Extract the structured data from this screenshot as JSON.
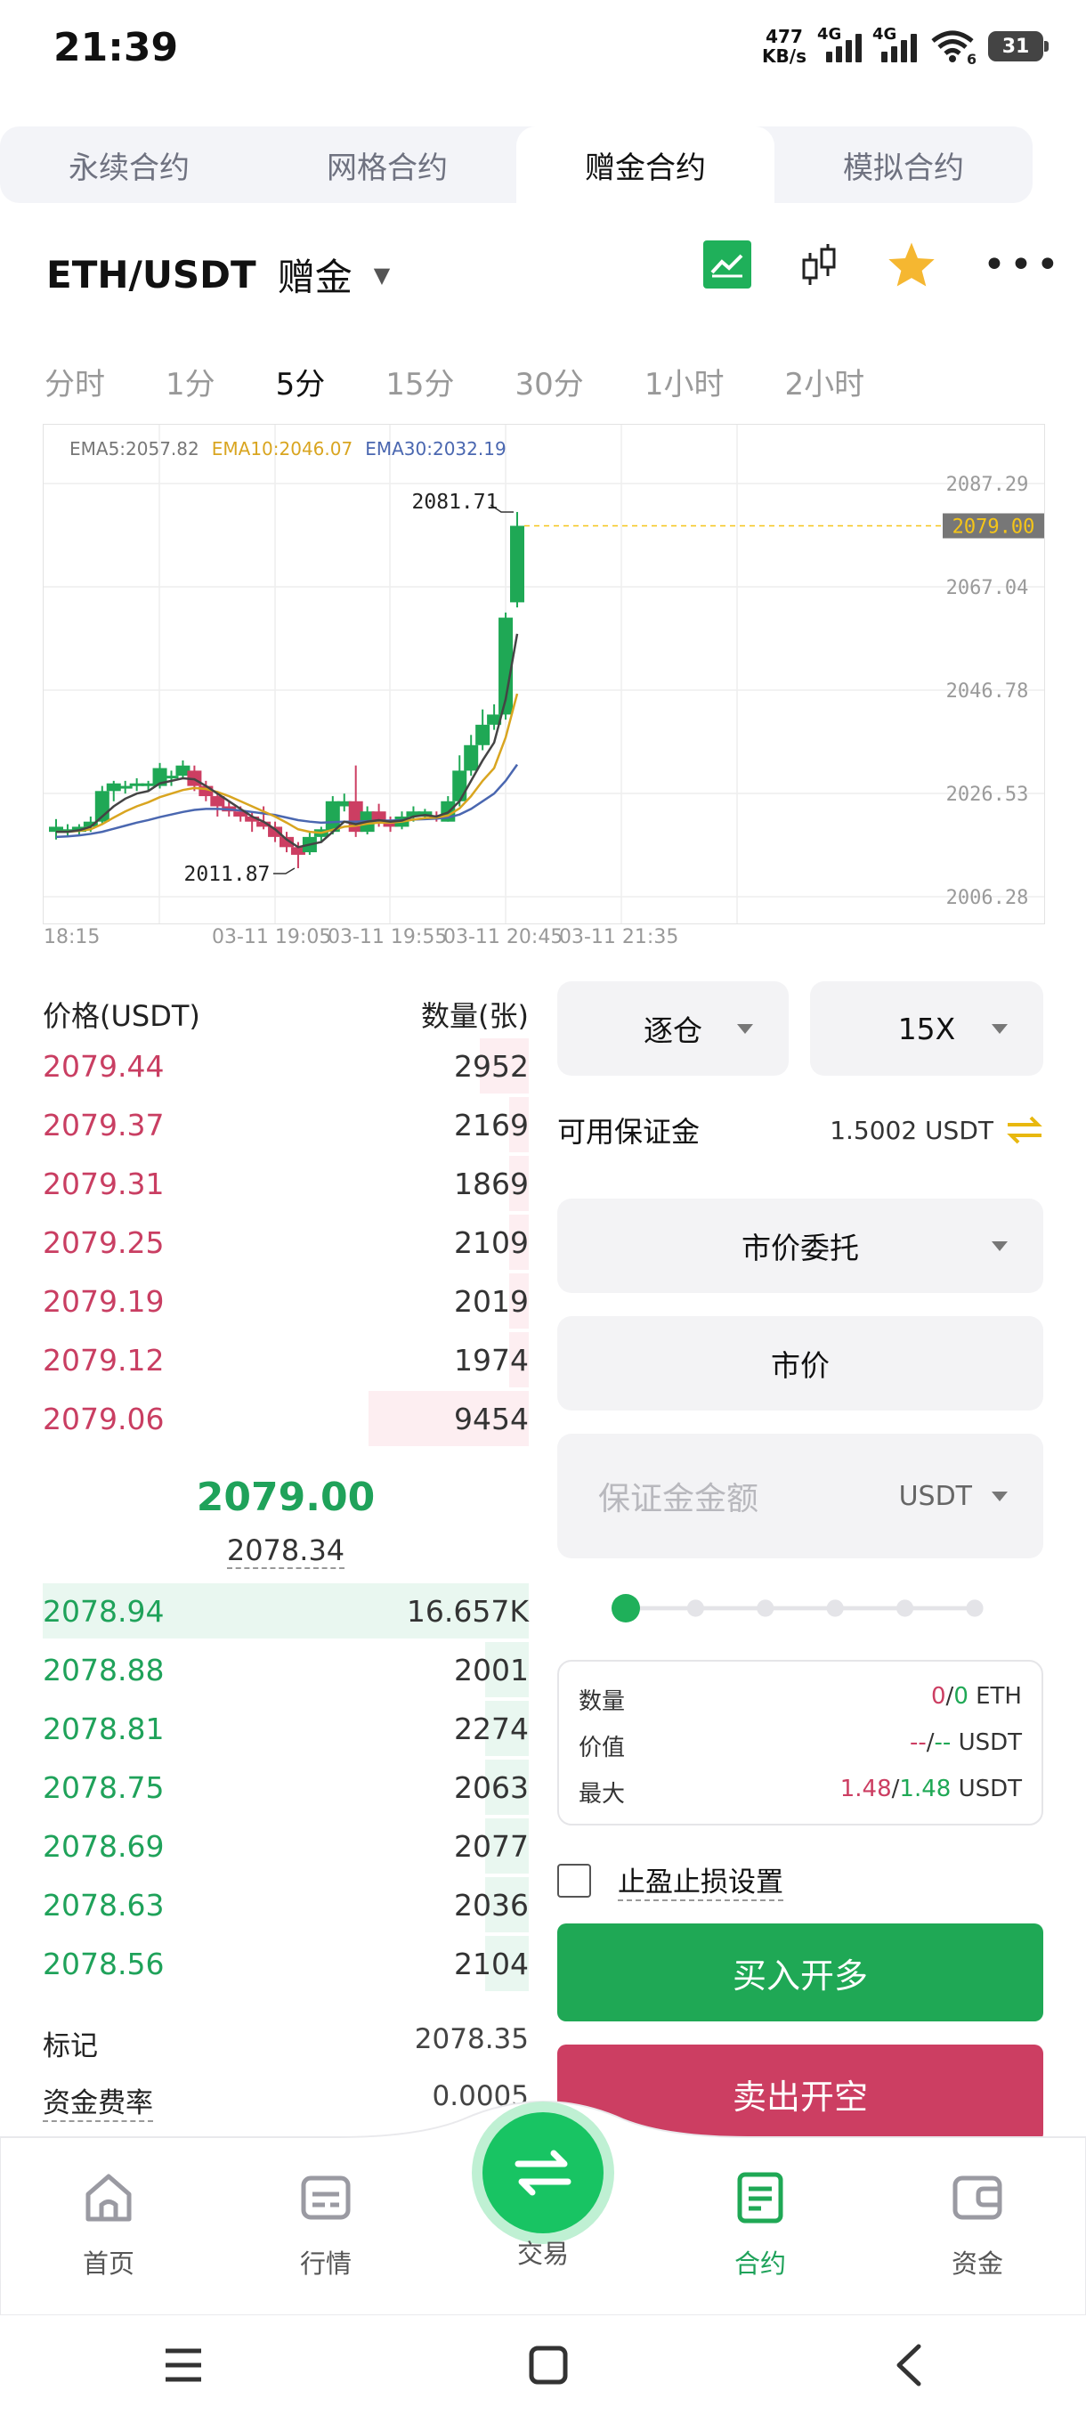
{
  "status": {
    "time": "21:39",
    "net_speed": "477",
    "net_unit": "KB/s",
    "net1": "4G",
    "net2": "4G",
    "wifi_badge": "6",
    "battery": "31"
  },
  "tabs": [
    "永续合约",
    "网格合约",
    "赠金合约",
    "模拟合约"
  ],
  "symbol": {
    "pair": "ETH/USDT",
    "mode": "赠金"
  },
  "timeframes": [
    "分时",
    "1分",
    "5分",
    "15分",
    "30分",
    "1小时",
    "2小时"
  ],
  "chart_data": {
    "type": "candlestick",
    "ema": [
      {
        "label": "EMA5:2057.82",
        "color": "#888888"
      },
      {
        "label": "EMA10:2046.07",
        "color": "#d9a520"
      },
      {
        "label": "EMA30:2032.19",
        "color": "#4a67b0"
      }
    ],
    "y_ticks": [
      "2087.29",
      "2067.04",
      "2046.78",
      "2026.53",
      "2006.28"
    ],
    "ylim": [
      2006.28,
      2087.29
    ],
    "current_price_label": "2079.00",
    "high_label": "2081.71",
    "low_label": "2011.87",
    "x_ticks": [
      "18:15",
      "03-11  19:05",
      "03-11  19:55",
      "03-11  20:45",
      "03-11  21:35"
    ],
    "candles": [
      [
        2019,
        2020,
        2017.5,
        2021.5
      ],
      [
        2019,
        2019.5,
        2018,
        2020.5
      ],
      [
        2019,
        2020,
        2018.5,
        2020.5
      ],
      [
        2020,
        2021,
        2019,
        2022
      ],
      [
        2021,
        2027,
        2020.5,
        2028
      ],
      [
        2027,
        2028.5,
        2025,
        2029
      ],
      [
        2028,
        2028,
        2026.5,
        2029
      ],
      [
        2028,
        2028.5,
        2027,
        2029.5
      ],
      [
        2028,
        2028.5,
        2027,
        2029
      ],
      [
        2028,
        2031.5,
        2027.5,
        2032.5
      ],
      [
        2030,
        2030,
        2028,
        2031
      ],
      [
        2030,
        2032,
        2029.5,
        2033
      ],
      [
        2031,
        2028,
        2027,
        2032
      ],
      [
        2028,
        2026,
        2025,
        2029
      ],
      [
        2026,
        2024,
        2022,
        2027
      ],
      [
        2024,
        2023,
        2022,
        2025
      ],
      [
        2023,
        2022,
        2021,
        2024
      ],
      [
        2022,
        2021,
        2019,
        2023
      ],
      [
        2021,
        2020,
        2019.5,
        2024
      ],
      [
        2020,
        2018,
        2017,
        2021
      ],
      [
        2018,
        2016,
        2015,
        2019
      ],
      [
        2016,
        2014.5,
        2011.87,
        2017
      ],
      [
        2015,
        2018,
        2014.5,
        2019
      ],
      [
        2018,
        2019.5,
        2017,
        2020
      ],
      [
        2019,
        2025,
        2018.5,
        2026
      ],
      [
        2024,
        2025,
        2023,
        2026.5
      ],
      [
        2025,
        2019,
        2018,
        2032
      ],
      [
        2019,
        2023,
        2018.5,
        2024
      ],
      [
        2023,
        2021,
        2020,
        2024.5
      ],
      [
        2021,
        2020,
        2019,
        2022
      ],
      [
        2020,
        2022,
        2019.5,
        2023
      ],
      [
        2022,
        2023,
        2021,
        2024
      ],
      [
        2022,
        2023,
        2021.5,
        2023.5
      ],
      [
        2022,
        2021.5,
        2021,
        2023
      ],
      [
        2021,
        2025,
        2021,
        2026
      ],
      [
        2025,
        2031,
        2024,
        2034
      ],
      [
        2031,
        2036,
        2030,
        2038
      ],
      [
        2036,
        2040,
        2035,
        2043
      ],
      [
        2040,
        2042,
        2039,
        2044
      ],
      [
        2042,
        2061,
        2041,
        2062
      ],
      [
        2064,
        2079,
        2063,
        2081.71
      ]
    ],
    "ema5": [
      2019,
      2019,
      2019.3,
      2020,
      2022,
      2024,
      2025.5,
      2026.5,
      2027,
      2028.5,
      2029,
      2029.5,
      2029.3,
      2028,
      2026.5,
      2025,
      2023.5,
      2022,
      2021,
      2019.5,
      2017.5,
      2016,
      2016.5,
      2017,
      2019,
      2021,
      2020.5,
      2021,
      2021.3,
      2021,
      2021.2,
      2022,
      2022.3,
      2022,
      2022.8,
      2025,
      2029,
      2033,
      2036.5,
      2045,
      2057.82
    ],
    "ema10": [
      2019,
      2019,
      2019.2,
      2019.5,
      2020.5,
      2021.8,
      2023,
      2024,
      2024.8,
      2025.8,
      2026.5,
      2027.2,
      2027.6,
      2027.4,
      2026.8,
      2026,
      2025,
      2024,
      2023,
      2022,
      2020.8,
      2019.5,
      2019,
      2018.8,
      2019.4,
      2020,
      2020.2,
      2020.6,
      2020.8,
      2020.8,
      2021,
      2021.4,
      2021.7,
      2021.8,
      2022.2,
      2023.6,
      2026,
      2029,
      2031.5,
      2037.5,
      2046.07
    ],
    "ema30": [
      2018,
      2018.1,
      2018.3,
      2018.6,
      2019,
      2019.6,
      2020.2,
      2020.8,
      2021.3,
      2021.9,
      2022.4,
      2022.9,
      2023.3,
      2023.5,
      2023.5,
      2023.4,
      2023.2,
      2022.9,
      2022.6,
      2022.3,
      2021.8,
      2021.3,
      2021,
      2020.8,
      2020.9,
      2021,
      2021,
      2021.1,
      2021.2,
      2021.2,
      2021.3,
      2021.4,
      2021.5,
      2021.6,
      2021.8,
      2022.4,
      2023.5,
      2025,
      2026.5,
      2029,
      2032.19
    ]
  },
  "orderbook": {
    "price_header": "价格(USDT)",
    "qty_header": "数量(张)",
    "asks": [
      {
        "price": "2079.44",
        "qty": "2952",
        "depth": 0.1
      },
      {
        "price": "2079.37",
        "qty": "2169",
        "depth": 0.04
      },
      {
        "price": "2079.31",
        "qty": "1869",
        "depth": 0.04
      },
      {
        "price": "2079.25",
        "qty": "2109",
        "depth": 0.04
      },
      {
        "price": "2079.19",
        "qty": "2019",
        "depth": 0.04
      },
      {
        "price": "2079.12",
        "qty": "1974",
        "depth": 0.04
      },
      {
        "price": "2079.06",
        "qty": "9454",
        "depth": 0.33
      }
    ],
    "last_price": "2079.00",
    "mark_price": "2078.34",
    "bids": [
      {
        "price": "2078.94",
        "qty": "16.657K",
        "depth": 1.0
      },
      {
        "price": "2078.88",
        "qty": "2001",
        "depth": 0.09
      },
      {
        "price": "2078.81",
        "qty": "2274",
        "depth": 0.09
      },
      {
        "price": "2078.75",
        "qty": "2063",
        "depth": 0.09
      },
      {
        "price": "2078.69",
        "qty": "2077",
        "depth": 0.09
      },
      {
        "price": "2078.63",
        "qty": "2036",
        "depth": 0.09
      },
      {
        "price": "2078.56",
        "qty": "2104",
        "depth": 0.09
      }
    ],
    "mark_label": "标记",
    "mark_value": "2078.35",
    "funding_label": "资金费率",
    "funding_value": "0.0005"
  },
  "order_form": {
    "margin_mode": "逐仓",
    "leverage": "15X",
    "avail_label": "可用保证金",
    "avail_value": "1.5002 USDT",
    "order_type": "市价委托",
    "price_field": "市价",
    "amount_placeholder": "保证金金额",
    "amount_unit": "USDT",
    "slider_value": 0,
    "qty_label": "数量",
    "qty_a": "0",
    "qty_b": "0",
    "qty_unit": "ETH",
    "value_label": "价值",
    "value_a": "--",
    "value_b": "--",
    "value_unit": "USDT",
    "max_label": "最大",
    "max_a": "1.48",
    "max_b": "1.48",
    "max_unit": "USDT",
    "tpsl_label": "止盈止损设置",
    "buy_label": "买入开多",
    "sell_label": "卖出开空"
  },
  "nav": [
    {
      "label": "首页",
      "icon": "home-icon"
    },
    {
      "label": "行情",
      "icon": "market-icon"
    },
    {
      "label": "交易",
      "icon": "swap-icon"
    },
    {
      "label": "合约",
      "icon": "contract-icon"
    },
    {
      "label": "资金",
      "icon": "wallet-icon"
    }
  ],
  "colors": {
    "up": "#1fa855",
    "down": "#cc3e62",
    "accent": "#f5c518"
  }
}
